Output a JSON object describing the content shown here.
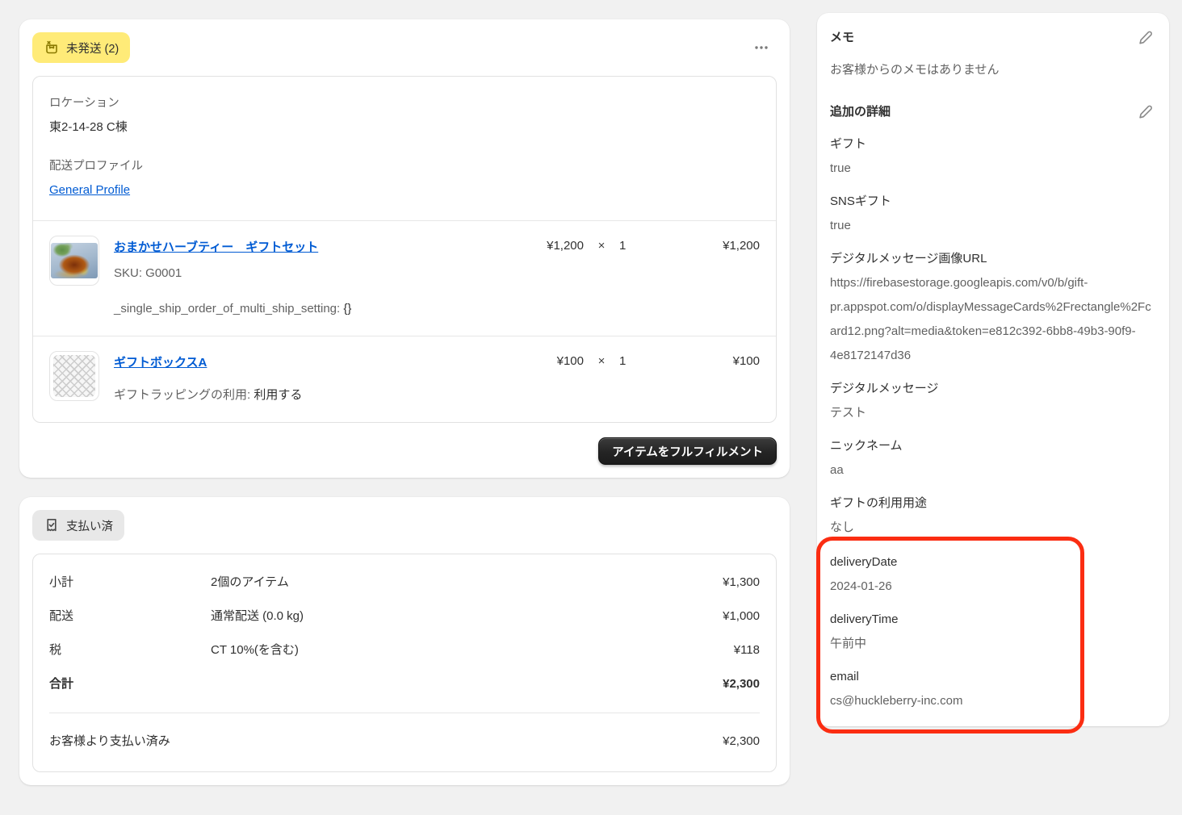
{
  "colors": {
    "page_background": "#f1f1f1",
    "card_background": "#ffffff",
    "badge_attention_bg": "#ffeb78",
    "badge_attention_icon": "#8a7a00",
    "badge_default_bg": "#e8e8e8",
    "link_blue": "#005bd3",
    "text_dark": "#303030",
    "text_muted": "#616161",
    "border": "#e1e1e1",
    "primary_button_bg": "#1c1c1c",
    "annotation_red": "#fb2d12"
  },
  "fulfillment_card": {
    "badge_label": "未発送 (2)",
    "location_label": "ロケーション",
    "location_value": "東2-14-28 C棟",
    "shipping_profile_label": "配送プロファイル",
    "shipping_profile_link": "General Profile",
    "items": [
      {
        "title": "おまかせハーブティー　ギフトセット",
        "sku": "SKU: G0001",
        "property_name": "_single_ship_order_of_multi_ship_setting:",
        "property_value": "{}",
        "unit_price": "¥1,200",
        "times": "×",
        "quantity": "1",
        "line_total": "¥1,200",
        "thumbnail": "herb-tea-photo"
      },
      {
        "title": "ギフトボックスA",
        "property_name": "ギフトラッピングの利用:",
        "property_value": "利用する",
        "unit_price": "¥100",
        "times": "×",
        "quantity": "1",
        "line_total": "¥100",
        "thumbnail": "transparent-checker-placeholder"
      }
    ],
    "fulfill_button_label": "アイテムをフルフィルメント"
  },
  "payment_card": {
    "badge_label": "支払い済",
    "rows": [
      {
        "label": "小計",
        "detail": "2個のアイテム",
        "amount": "¥1,300"
      },
      {
        "label": "配送",
        "detail": "通常配送 (0.0 kg)",
        "amount": "¥1,000"
      },
      {
        "label": "税",
        "detail": "CT 10%(を含む)",
        "amount": "¥118"
      },
      {
        "label": "合計",
        "detail": "",
        "amount": "¥2,300"
      }
    ],
    "paid_row": {
      "label": "お客様より支払い済み",
      "amount": "¥2,300"
    }
  },
  "sidebar": {
    "notes": {
      "title": "メモ",
      "empty_text": "お客様からのメモはありません"
    },
    "details": {
      "title": "追加の詳細",
      "fields": [
        {
          "label": "ギフト",
          "value": "true"
        },
        {
          "label": "SNSギフト",
          "value": "true"
        },
        {
          "label": "デジタルメッセージ画像URL",
          "value": "https://firebasestorage.googleapis.com/v0/b/gift-pr.appspot.com/o/displayMessageCards%2Frectangle%2Fcard12.png?alt=media&token=e812c392-6bb8-49b3-90f9-4e8172147d36"
        },
        {
          "label": "デジタルメッセージ",
          "value": "テスト"
        },
        {
          "label": "ニックネーム",
          "value": "aa"
        },
        {
          "label": "ギフトの利用用途",
          "value": "なし"
        },
        {
          "label": "deliveryDate",
          "value": "2024-01-26"
        },
        {
          "label": "deliveryTime",
          "value": "午前中"
        },
        {
          "label": "email",
          "value": "cs@huckleberry-inc.com"
        }
      ]
    }
  }
}
